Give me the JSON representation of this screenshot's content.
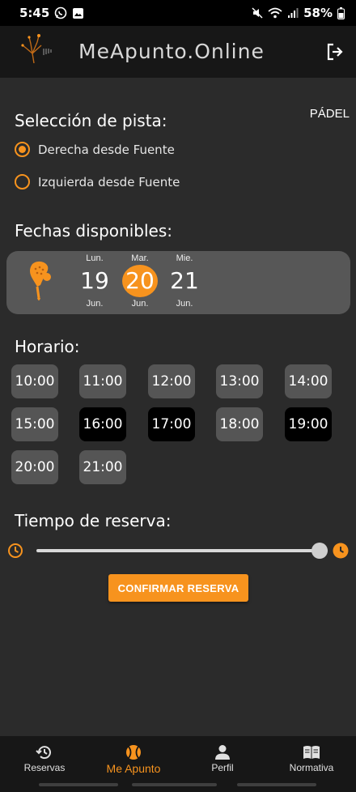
{
  "status": {
    "time": "5:45",
    "battery": "58%"
  },
  "header": {
    "title": "MeApunto.Online"
  },
  "sport": "PÁDEL",
  "court": {
    "title": "Selección de pista:",
    "options": [
      {
        "label": "Derecha desde Fuente",
        "selected": true
      },
      {
        "label": "Izquierda desde Fuente",
        "selected": false
      }
    ]
  },
  "dates": {
    "title": "Fechas disponibles:",
    "items": [
      {
        "day": "Lun.",
        "num": "19",
        "month": "Jun.",
        "selected": false
      },
      {
        "day": "Mar.",
        "num": "20",
        "month": "Jun.",
        "selected": true
      },
      {
        "day": "Mie.",
        "num": "21",
        "month": "Jun.",
        "selected": false
      }
    ]
  },
  "schedule": {
    "title": "Horario:",
    "hours": [
      {
        "label": "10:00",
        "busy": false
      },
      {
        "label": "11:00",
        "busy": false
      },
      {
        "label": "12:00",
        "busy": false
      },
      {
        "label": "13:00",
        "busy": false
      },
      {
        "label": "14:00",
        "busy": false
      },
      {
        "label": "15:00",
        "busy": false
      },
      {
        "label": "16:00",
        "busy": true
      },
      {
        "label": "17:00",
        "busy": true
      },
      {
        "label": "18:00",
        "busy": false
      },
      {
        "label": "19:00",
        "busy": true
      },
      {
        "label": "20:00",
        "busy": false
      },
      {
        "label": "21:00",
        "busy": false
      }
    ]
  },
  "duration": {
    "title": "Tiempo de reserva:",
    "value_fraction": 1.0
  },
  "confirm_label": "CONFIRMAR RESERVA",
  "nav": [
    {
      "label": "Reservas",
      "icon": "history-icon",
      "active": false
    },
    {
      "label": "Me Apunto",
      "icon": "ball-icon",
      "active": true
    },
    {
      "label": "Perfil",
      "icon": "person-icon",
      "active": false
    },
    {
      "label": "Normativa",
      "icon": "book-icon",
      "active": false
    }
  ],
  "colors": {
    "accent": "#f7931e",
    "background": "#2b2b2b",
    "header": "#171717",
    "slot": "#555555",
    "slot_busy": "#000000"
  }
}
